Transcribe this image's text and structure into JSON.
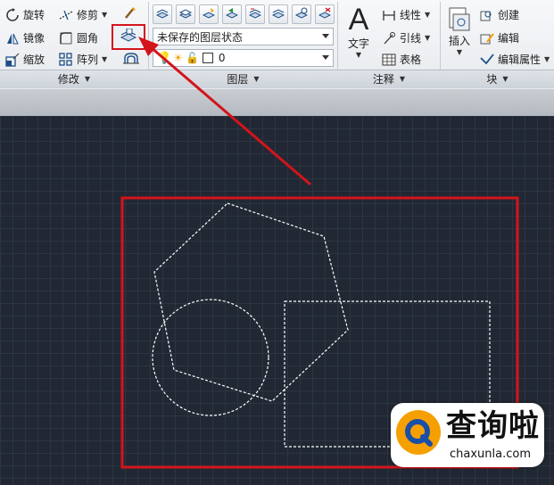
{
  "modify_panel": {
    "rotate": "旋转",
    "trim": "修剪",
    "mirror": "镜像",
    "fillet": "圆角",
    "scale": "缩放",
    "array": "阵列",
    "title": "修改"
  },
  "layers_panel": {
    "layer_state": "未保存的图层状态",
    "current_layer": "0",
    "title": "图层"
  },
  "annotation_panel": {
    "text_glyph": "A",
    "text": "文字",
    "linear": "线性",
    "leader": "引线",
    "table": "表格",
    "title": "注释"
  },
  "block_panel": {
    "insert": "插入",
    "create": "创建",
    "edit": "编辑",
    "edit_attributes": "编辑属性",
    "title": "块"
  },
  "watermark": {
    "name": "查询啦",
    "url": "chaxunla.com"
  },
  "colors": {
    "highlight": "#d4141b",
    "canvas": "#212833",
    "accent_orange": "#f5a000"
  }
}
